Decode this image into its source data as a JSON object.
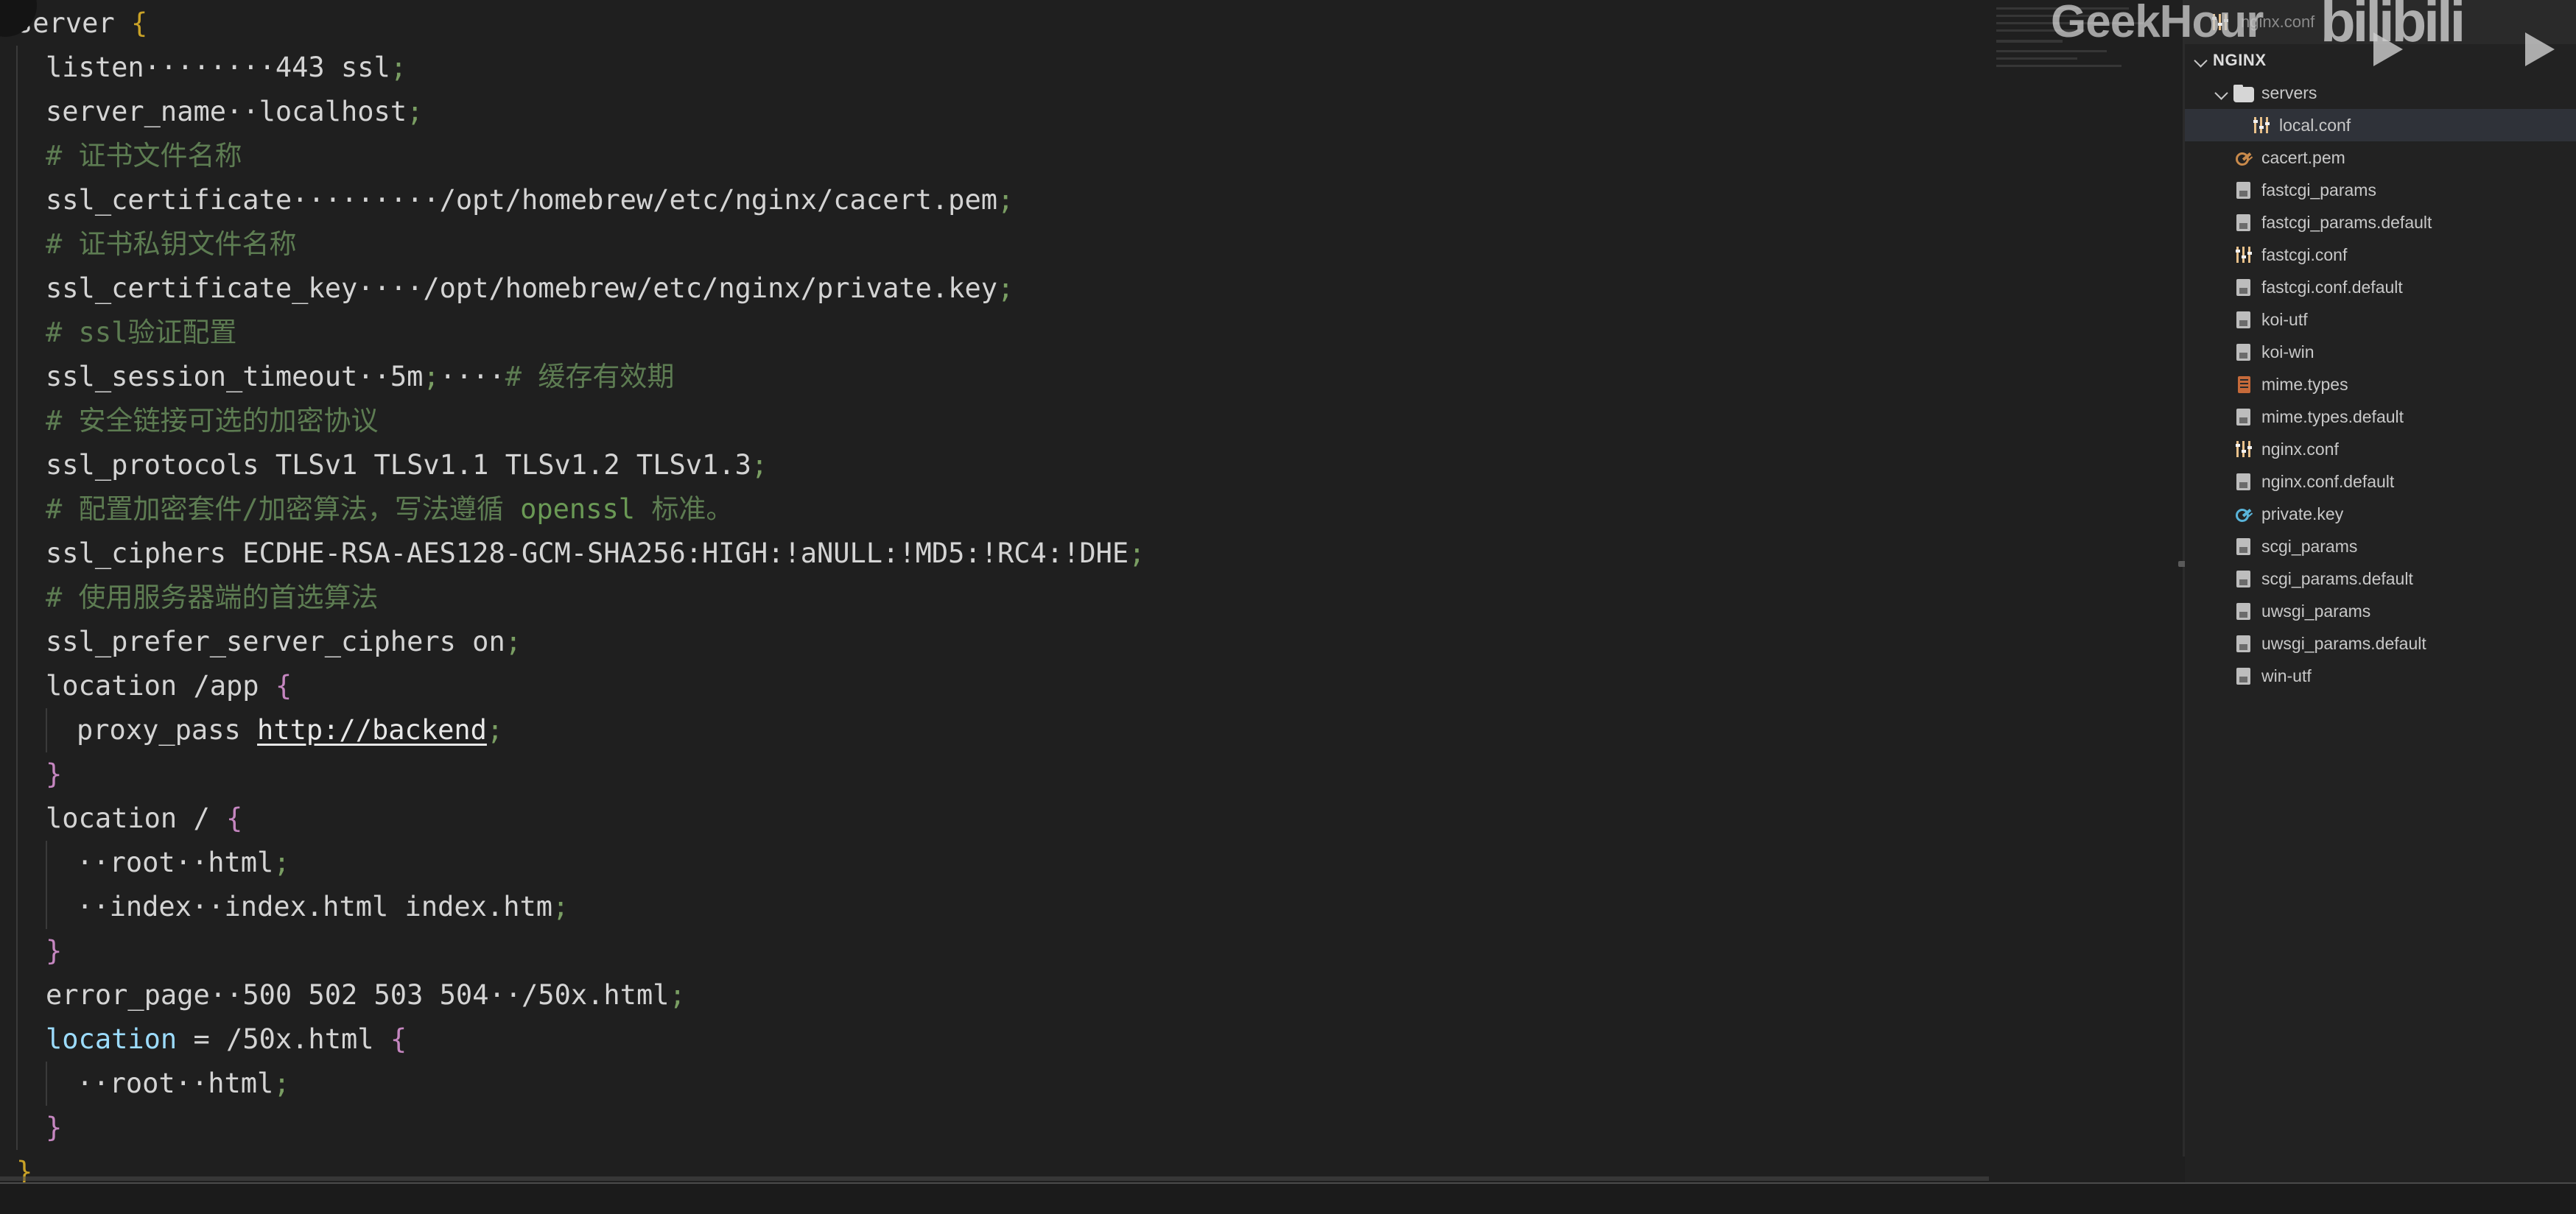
{
  "editor": {
    "language": "nginx",
    "colors": {
      "background": "#1f1f1f",
      "foreground": "#d4d4d4",
      "comment": "#6a9955",
      "semicolon": "#7a9e63",
      "brace_yellow": "#c9a227",
      "brace_purple": "#c586c0",
      "brace_blue": "#4fc1ff",
      "identifier_blue": "#9cdcfe"
    },
    "lines": [
      {
        "indent": 0,
        "tokens": [
          {
            "t": "server ",
            "c": "plain"
          },
          {
            "t": "{",
            "c": "brace-y"
          }
        ]
      },
      {
        "indent": 1,
        "tokens": [
          {
            "t": "listen",
            "c": "plain"
          },
          {
            "t": "········",
            "c": "ws"
          },
          {
            "t": "443 ssl",
            "c": "plain"
          },
          {
            "t": ";",
            "c": "semi"
          }
        ]
      },
      {
        "indent": 1,
        "tokens": [
          {
            "t": "server_name",
            "c": "plain"
          },
          {
            "t": "··",
            "c": "ws"
          },
          {
            "t": "localhost",
            "c": "plain"
          },
          {
            "t": ";",
            "c": "semi"
          }
        ]
      },
      {
        "indent": 1,
        "tokens": [
          {
            "t": "# 证书文件名称",
            "c": "comment"
          }
        ]
      },
      {
        "indent": 1,
        "tokens": [
          {
            "t": "ssl_certificate",
            "c": "plain"
          },
          {
            "t": "·········",
            "c": "ws"
          },
          {
            "t": "/opt/homebrew/etc/nginx/cacert.pem",
            "c": "plain"
          },
          {
            "t": ";",
            "c": "semi"
          }
        ]
      },
      {
        "indent": 1,
        "tokens": [
          {
            "t": "# 证书私钥文件名称",
            "c": "comment"
          }
        ]
      },
      {
        "indent": 1,
        "tokens": [
          {
            "t": "ssl_certificate_key",
            "c": "plain"
          },
          {
            "t": "····",
            "c": "ws"
          },
          {
            "t": "/opt/homebrew/etc/nginx/private.key",
            "c": "plain"
          },
          {
            "t": ";",
            "c": "semi"
          }
        ]
      },
      {
        "indent": 1,
        "tokens": [
          {
            "t": "# ssl验证配置",
            "c": "comment"
          }
        ]
      },
      {
        "indent": 1,
        "tokens": [
          {
            "t": "ssl_session_timeout",
            "c": "plain"
          },
          {
            "t": "··",
            "c": "ws"
          },
          {
            "t": "5m",
            "c": "plain"
          },
          {
            "t": ";",
            "c": "semi"
          },
          {
            "t": "····",
            "c": "ws"
          },
          {
            "t": "# 缓存有效期",
            "c": "comment"
          }
        ]
      },
      {
        "indent": 1,
        "tokens": [
          {
            "t": "# 安全链接可选的加密协议",
            "c": "comment"
          }
        ]
      },
      {
        "indent": 1,
        "tokens": [
          {
            "t": "ssl_protocols TLSv1 TLSv1.1 TLSv1.2 TLSv1.3",
            "c": "plain"
          },
          {
            "t": ";",
            "c": "semi"
          }
        ]
      },
      {
        "indent": 1,
        "tokens": [
          {
            "t": "# 配置加密套件/加密算法，写法遵循 ",
            "c": "comment"
          },
          {
            "t": "openssl",
            "c": "comment-kw"
          },
          {
            "t": " 标准。",
            "c": "comment"
          }
        ]
      },
      {
        "indent": 1,
        "tokens": [
          {
            "t": "ssl_ciphers ECDHE-RSA-AES128-GCM-SHA256:HIGH:!aNULL:!MD5:!RC4:!DHE",
            "c": "plain"
          },
          {
            "t": ";",
            "c": "semi"
          }
        ]
      },
      {
        "indent": 1,
        "tokens": [
          {
            "t": "# 使用服务器端的首选算法",
            "c": "comment"
          }
        ]
      },
      {
        "indent": 1,
        "tokens": [
          {
            "t": "ssl_prefer_server_ciphers on",
            "c": "plain"
          },
          {
            "t": ";",
            "c": "semi"
          }
        ]
      },
      {
        "indent": 1,
        "tokens": [
          {
            "t": "location /app ",
            "c": "plain"
          },
          {
            "t": "{",
            "c": "brace-p"
          }
        ]
      },
      {
        "indent": 2,
        "tokens": [
          {
            "t": "proxy_pass ",
            "c": "plain"
          },
          {
            "t": "http://backend",
            "c": "link"
          },
          {
            "t": ";",
            "c": "semi"
          }
        ]
      },
      {
        "indent": 1,
        "tokens": [
          {
            "t": "}",
            "c": "brace-p"
          }
        ]
      },
      {
        "indent": 1,
        "tokens": [
          {
            "t": "location / ",
            "c": "plain"
          },
          {
            "t": "{",
            "c": "brace-p"
          }
        ]
      },
      {
        "indent": 2,
        "tokens": [
          {
            "t": "··",
            "c": "ws"
          },
          {
            "t": "root",
            "c": "plain"
          },
          {
            "t": "··",
            "c": "ws"
          },
          {
            "t": "html",
            "c": "plain"
          },
          {
            "t": ";",
            "c": "semi"
          }
        ]
      },
      {
        "indent": 2,
        "tokens": [
          {
            "t": "··",
            "c": "ws"
          },
          {
            "t": "index",
            "c": "plain"
          },
          {
            "t": "··",
            "c": "ws"
          },
          {
            "t": "index.html index.htm",
            "c": "plain"
          },
          {
            "t": ";",
            "c": "semi"
          }
        ]
      },
      {
        "indent": 1,
        "tokens": [
          {
            "t": "}",
            "c": "brace-p"
          }
        ]
      },
      {
        "indent": 1,
        "tokens": [
          {
            "t": "error_page",
            "c": "plain"
          },
          {
            "t": "··",
            "c": "ws"
          },
          {
            "t": "500 502 503 504",
            "c": "plain"
          },
          {
            "t": "··",
            "c": "ws"
          },
          {
            "t": "/50x.html",
            "c": "plain"
          },
          {
            "t": ";",
            "c": "semi"
          }
        ]
      },
      {
        "indent": 1,
        "tokens": [
          {
            "t": "location",
            "c": "blue"
          },
          {
            "t": " = /50x.html ",
            "c": "plain"
          },
          {
            "t": "{",
            "c": "brace-p"
          }
        ]
      },
      {
        "indent": 2,
        "tokens": [
          {
            "t": "··",
            "c": "ws"
          },
          {
            "t": "root",
            "c": "plain"
          },
          {
            "t": "··",
            "c": "ws"
          },
          {
            "t": "html",
            "c": "plain"
          },
          {
            "t": ";",
            "c": "semi"
          }
        ]
      },
      {
        "indent": 1,
        "tokens": [
          {
            "t": "}",
            "c": "brace-p"
          }
        ]
      },
      {
        "indent": 0,
        "tokens": [
          {
            "t": "}",
            "c": "brace-y"
          }
        ]
      }
    ]
  },
  "sidebar": {
    "ghost_tab_label": "nginx.conf",
    "root": {
      "label": "NGINX",
      "expanded": true
    },
    "items": [
      {
        "label": "servers",
        "icon": "folder-icon",
        "depth": 1,
        "kind": "folder",
        "expanded": true,
        "selected": false
      },
      {
        "label": "local.conf",
        "icon": "nginx-conf-icon",
        "depth": 2,
        "kind": "file",
        "selected": true
      },
      {
        "label": "cacert.pem",
        "icon": "key-orange-icon",
        "depth": 1,
        "kind": "file",
        "selected": false
      },
      {
        "label": "fastcgi_params",
        "icon": "file-icon",
        "depth": 1,
        "kind": "file",
        "selected": false
      },
      {
        "label": "fastcgi_params.default",
        "icon": "file-icon",
        "depth": 1,
        "kind": "file",
        "selected": false
      },
      {
        "label": "fastcgi.conf",
        "icon": "nginx-conf-icon",
        "depth": 1,
        "kind": "file",
        "selected": false
      },
      {
        "label": "fastcgi.conf.default",
        "icon": "file-icon",
        "depth": 1,
        "kind": "file",
        "selected": false
      },
      {
        "label": "koi-utf",
        "icon": "file-icon",
        "depth": 1,
        "kind": "file",
        "selected": false
      },
      {
        "label": "koi-win",
        "icon": "file-icon",
        "depth": 1,
        "kind": "file",
        "selected": false
      },
      {
        "label": "mime.types",
        "icon": "mime-types-icon",
        "depth": 1,
        "kind": "file",
        "selected": false
      },
      {
        "label": "mime.types.default",
        "icon": "file-icon",
        "depth": 1,
        "kind": "file",
        "selected": false
      },
      {
        "label": "nginx.conf",
        "icon": "nginx-conf-icon",
        "depth": 1,
        "kind": "file",
        "selected": false
      },
      {
        "label": "nginx.conf.default",
        "icon": "file-icon",
        "depth": 1,
        "kind": "file",
        "selected": false
      },
      {
        "label": "private.key",
        "icon": "key-blue-icon",
        "depth": 1,
        "kind": "file",
        "selected": false
      },
      {
        "label": "scgi_params",
        "icon": "file-icon",
        "depth": 1,
        "kind": "file",
        "selected": false
      },
      {
        "label": "scgi_params.default",
        "icon": "file-icon",
        "depth": 1,
        "kind": "file",
        "selected": false
      },
      {
        "label": "uwsgi_params",
        "icon": "file-icon",
        "depth": 1,
        "kind": "file",
        "selected": false
      },
      {
        "label": "uwsgi_params.default",
        "icon": "file-icon",
        "depth": 1,
        "kind": "file",
        "selected": false
      },
      {
        "label": "win-utf",
        "icon": "file-icon",
        "depth": 1,
        "kind": "file",
        "selected": false
      }
    ]
  },
  "watermarks": {
    "brand": "GeekHour",
    "platform": "bilibili"
  }
}
